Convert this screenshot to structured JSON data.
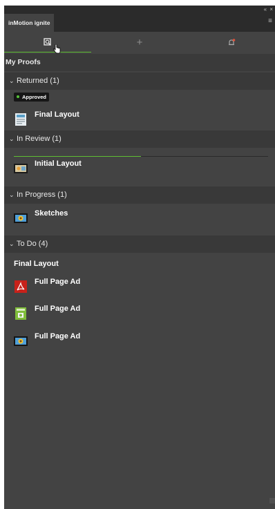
{
  "panel": {
    "tab_label": "inMotion ignite",
    "controls": "« ×",
    "menu_glyph": "≡"
  },
  "toolbar": {
    "buttons": [
      {
        "icon": "proof-search-icon",
        "active": true
      },
      {
        "icon": "plus-icon",
        "glyph": "+"
      },
      {
        "icon": "notification-icon"
      }
    ],
    "accent_color": "#5fbf33"
  },
  "my_proofs": {
    "title": "My Proofs"
  },
  "sections": {
    "returned": {
      "label": "Returned (1)",
      "badge": "Approved",
      "items": [
        {
          "label": "Final Layout",
          "icon": "layout-thumbnail-icon"
        }
      ]
    },
    "in_review": {
      "label": "In Review (1)",
      "progress": 0.5,
      "items": [
        {
          "label": "Initial Layout",
          "icon": "image-thumbnail-icon"
        }
      ]
    },
    "in_progress": {
      "label": "In Progress (1)",
      "items": [
        {
          "label": "Sketches",
          "icon": "flower-thumbnail-icon"
        }
      ]
    },
    "to_do": {
      "label": "To Do (4)",
      "group_title": "Final Layout",
      "items": [
        {
          "label": "Full Page Ad",
          "icon": "pdf-icon"
        },
        {
          "label": "Full Page Ad",
          "icon": "ad-thumbnail-icon"
        },
        {
          "label": "Full Page Ad",
          "icon": "flower-thumbnail-icon"
        }
      ]
    }
  }
}
